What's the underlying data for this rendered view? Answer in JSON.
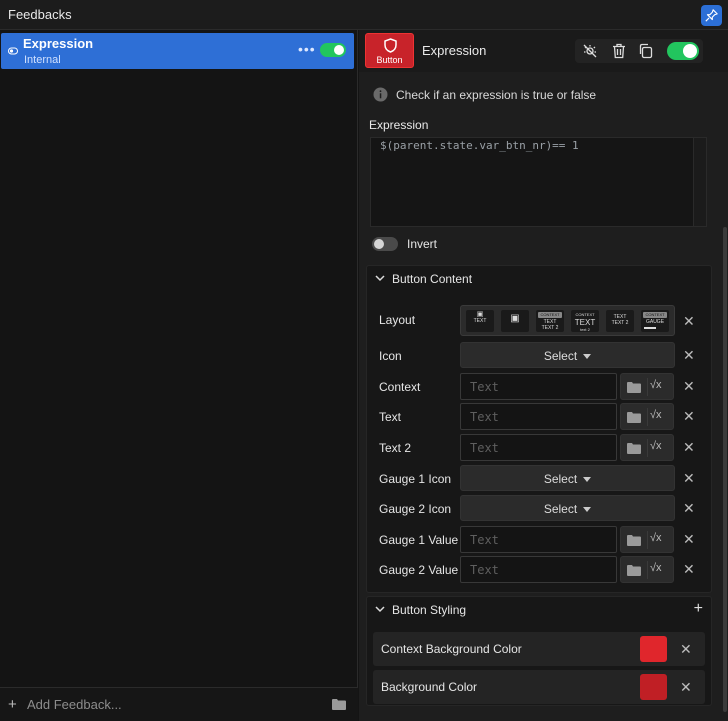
{
  "panel": {
    "title": "Feedbacks"
  },
  "feedback_list": {
    "items": [
      {
        "name": "Expression",
        "source": "Internal",
        "enabled": true
      }
    ],
    "add_label": "Add Feedback..."
  },
  "editor": {
    "thumb_label": "Button",
    "title": "Expression",
    "enabled": true,
    "description": "Check if an expression is true or false",
    "expression_label": "Expression",
    "expression_value": "$(parent.state.var_btn_nr)== 1",
    "invert_label": "Invert",
    "invert_enabled": false
  },
  "button_content": {
    "title": "Button Content",
    "layout_label": "Layout",
    "layout_options": [
      {
        "tag": "",
        "line1": "TEXT",
        "line2": ""
      },
      {
        "tag": "",
        "line1": "",
        "line2": ""
      },
      {
        "tag": "CONTEXT",
        "line1": "TEXT",
        "line2": "TEXT 2"
      },
      {
        "tag": "CONTEXT",
        "line1": "TEXT",
        "line2": "text 2"
      },
      {
        "tag": "",
        "line1": "TEXT",
        "line2": "TEXT 2"
      },
      {
        "tag": "CONTEXT",
        "line1": "GAUGE",
        "line2": ""
      }
    ],
    "rows": [
      {
        "label": "Icon",
        "kind": "select",
        "value": "Select"
      },
      {
        "label": "Context",
        "kind": "text",
        "placeholder": "Text"
      },
      {
        "label": "Text",
        "kind": "text",
        "placeholder": "Text"
      },
      {
        "label": "Text 2",
        "kind": "text",
        "placeholder": "Text"
      },
      {
        "label": "Gauge 1 Icon",
        "kind": "select",
        "value": "Select"
      },
      {
        "label": "Gauge 2 Icon",
        "kind": "select",
        "value": "Select"
      },
      {
        "label": "Gauge 1 Value",
        "kind": "text",
        "placeholder": "Text"
      },
      {
        "label": "Gauge 2 Value",
        "kind": "text",
        "placeholder": "Text"
      }
    ],
    "expr_symbol": "√x"
  },
  "button_styling": {
    "title": "Button Styling",
    "rows": [
      {
        "label": "Context Background Color",
        "color": "#e0262c"
      },
      {
        "label": "Background Color",
        "color": "#c01f25"
      }
    ]
  }
}
